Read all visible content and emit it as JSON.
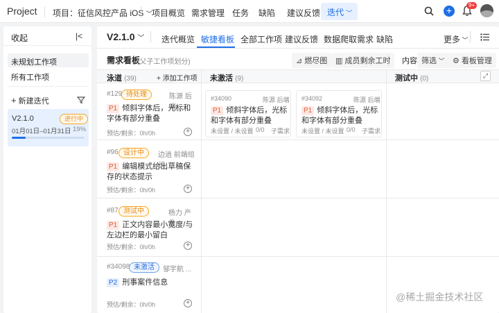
{
  "app": {
    "brand": "Project"
  },
  "nav": {
    "project_label": "项目：征信风控产品 iOS",
    "items": [
      "项目概览",
      "需求管理",
      "任务",
      "缺陷",
      "建议反馈"
    ],
    "active": "迭代",
    "notification_count": "9+"
  },
  "sidebar": {
    "title": "收起",
    "items": [
      "未规划工作项",
      "所有工作项"
    ],
    "new_iteration": "新建迭代",
    "iteration": {
      "name": "V2.1.0",
      "status": "进行中",
      "dates": "01月01日–01月31日",
      "progress_label": "19%",
      "progress": 0.19
    }
  },
  "main": {
    "version": "V2.1.0",
    "tabs": [
      "迭代概览",
      "敏捷看板",
      "全部工作项",
      "建议反馈",
      "数据爬取需求",
      "缺陷"
    ],
    "active_tab": "敏捷看板",
    "more": "更多",
    "board_title": "需求看板",
    "board_subtitle": "(父子工作项划分)",
    "burndown": "燃尽图",
    "member_hours": "成员剩余工时",
    "content_label": "内容",
    "filter_label": "筛选",
    "board_manage": "看板管理",
    "add_item": "添加工作项"
  },
  "columns": [
    {
      "name": "泳道",
      "count": "(39)"
    },
    {
      "name": "未激活",
      "count": "(9)"
    },
    {
      "name": "测试中",
      "count": "(0)"
    }
  ],
  "swimlanes": [
    {
      "id": "#129",
      "status": "待处理",
      "status_style": "b-or",
      "owner": "陈源 后端",
      "priority": "P1",
      "title": "倾斜字体后，光标和字体有部分重叠",
      "meta": "预估/剩余：0h/0h"
    },
    {
      "id": "#96",
      "status": "设计中",
      "status_style": "b-or",
      "owner": "边逍 前端组长",
      "priority": "P1",
      "title": "编辑模式给出草稿保存的状态提示",
      "meta": "预估/剩余：0h/0h"
    },
    {
      "id": "#87",
      "status": "测试中",
      "status_style": "b-or",
      "owner": "杨力 产品",
      "priority": "P1",
      "title": "正文内容最小宽度/与左边栏的最小留白",
      "meta": "预估/剩余：0h/0h"
    },
    {
      "id": "#34098",
      "status": "未激活",
      "status_style": "b-bl",
      "owner": "邹宇航 ...",
      "priority": "P2",
      "title": "刑事案件信息",
      "meta": "预估/剩余：0h/0h"
    }
  ],
  "inactive_cards": [
    {
      "id": "#34090",
      "owner": "陈源 后端",
      "priority": "P1",
      "title": "倾斜字体后，光标和字体有部分重叠",
      "meta": "未设置 / 未设置",
      "ratio": "0/0",
      "sub": "子需求"
    },
    {
      "id": "#34092",
      "owner": "陈源 后端",
      "priority": "P1",
      "title": "倾斜字体后，光标和字体有部分重叠",
      "meta": "未设置 / 未设置",
      "ratio": "0/0",
      "sub": "子需求"
    }
  ],
  "watermark": "@稀土掘金技术社区"
}
